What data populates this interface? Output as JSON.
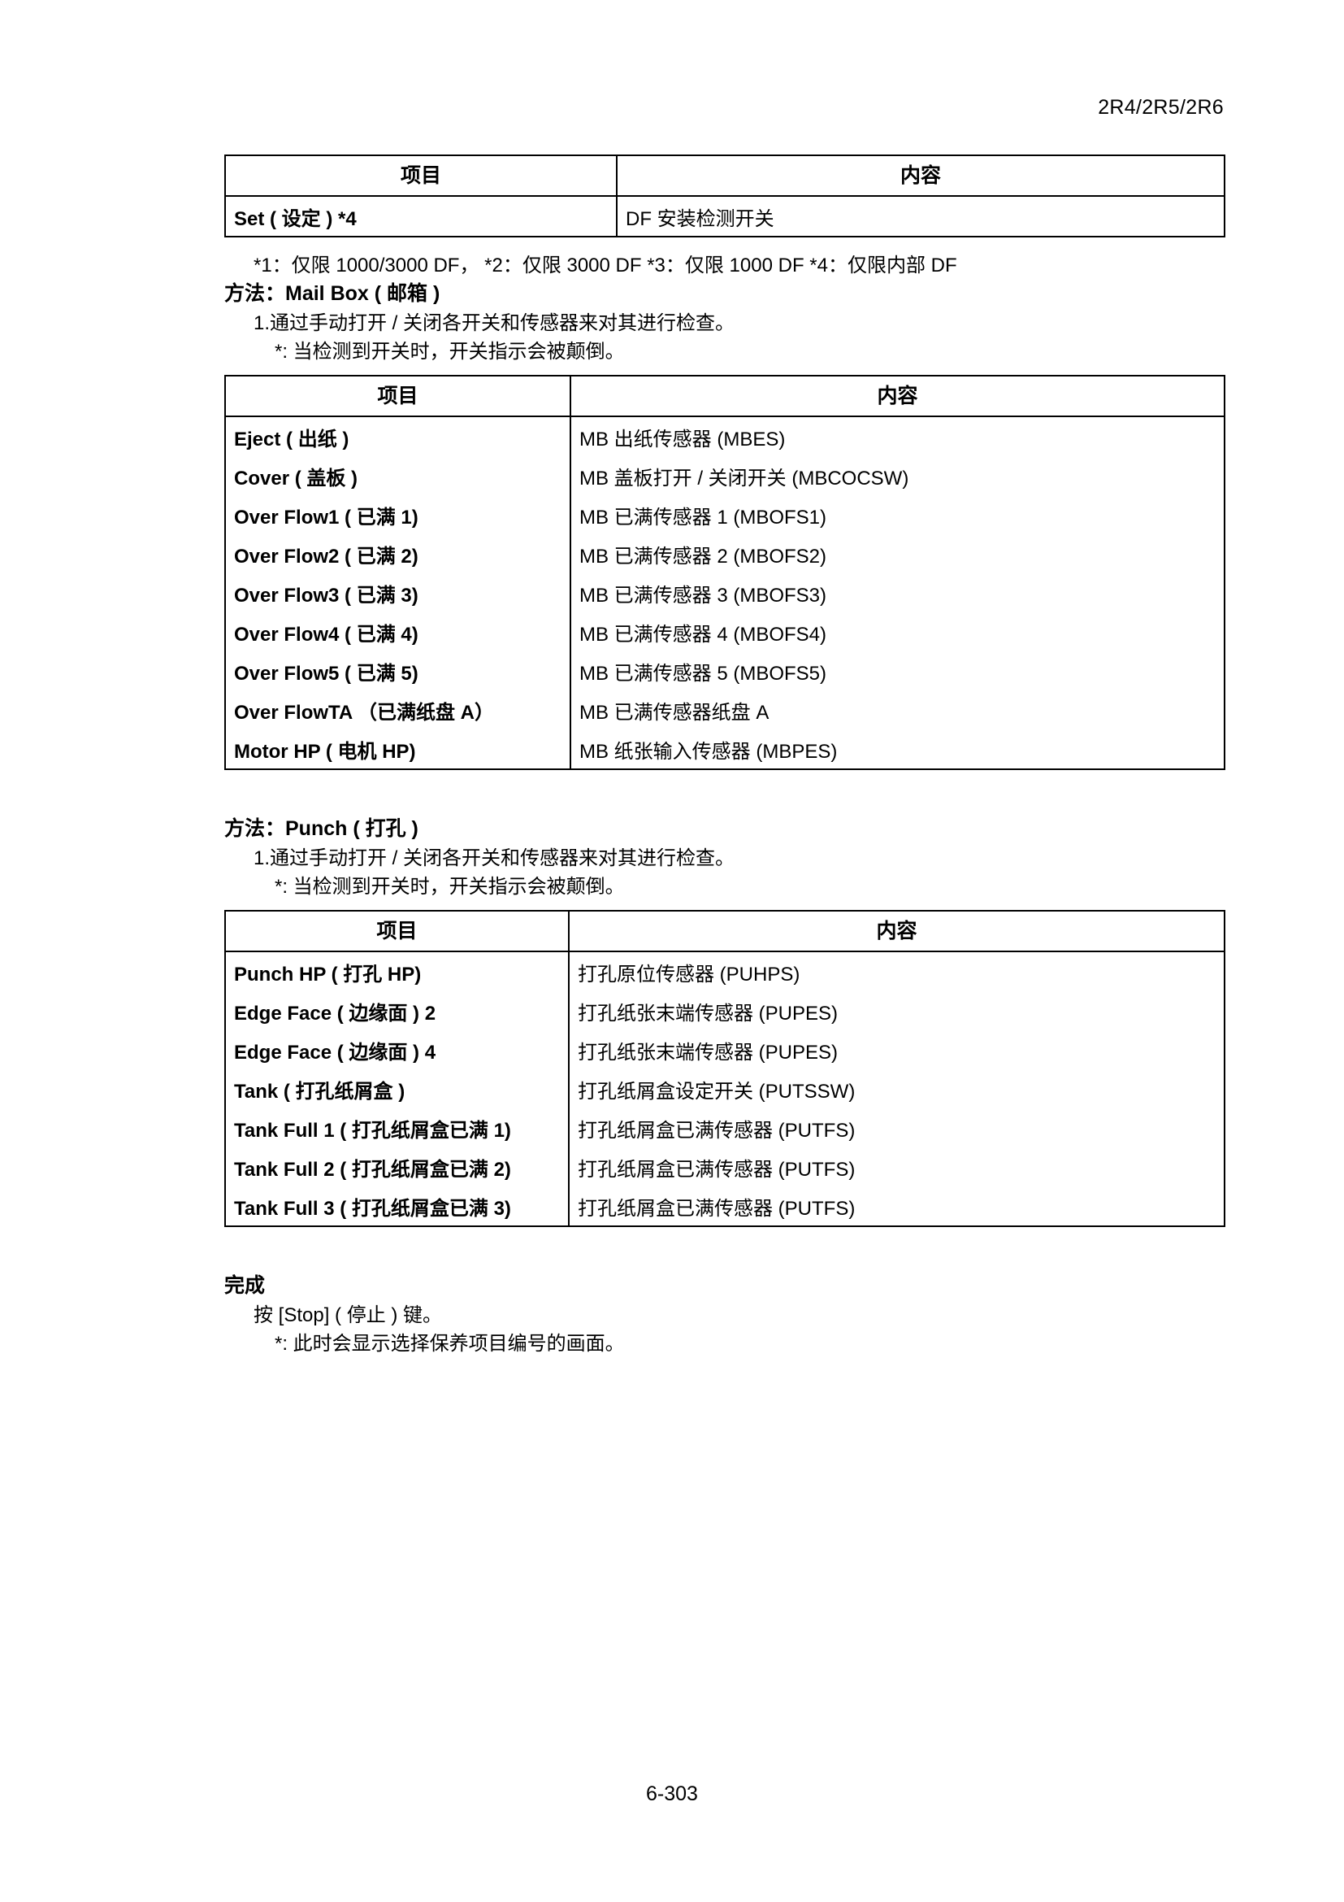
{
  "header": {
    "model_code": "2R4/2R5/2R6"
  },
  "table_set": {
    "headers": [
      "项目",
      "内容"
    ],
    "rows": [
      {
        "item": "Set ( 设定 ) *4",
        "content": "DF 安装检测开关"
      }
    ]
  },
  "footnote": "*1：仅限 1000/3000 DF，  *2：仅限 3000 DF *3：仅限 1000 DF *4：仅限内部 DF",
  "mailbox_section": {
    "heading": "方法：Mail Box ( 邮箱 )",
    "step": "1.通过手动打开 / 关闭各开关和传感器来对其进行检查。",
    "note": "*: 当检测到开关时，开关指示会被颠倒。",
    "table": {
      "headers": [
        "项目",
        "内容"
      ],
      "rows": [
        {
          "item": "Eject ( 出纸 )",
          "content": "MB 出纸传感器 (MBES)"
        },
        {
          "item": "Cover ( 盖板 )",
          "content": "MB 盖板打开 / 关闭开关 (MBCOCSW)"
        },
        {
          "item": "Over Flow1 ( 已满 1)",
          "content": "MB 已满传感器 1 (MBOFS1)"
        },
        {
          "item": "Over Flow2 ( 已满 2)",
          "content": "MB 已满传感器 2 (MBOFS2)"
        },
        {
          "item": "Over Flow3 ( 已满 3)",
          "content": "MB 已满传感器 3 (MBOFS3)"
        },
        {
          "item": "Over Flow4 ( 已满 4)",
          "content": "MB 已满传感器 4 (MBOFS4)"
        },
        {
          "item": "Over Flow5 ( 已满 5)",
          "content": "MB 已满传感器 5 (MBOFS5)"
        },
        {
          "item": "Over FlowTA （已满纸盘 A）",
          "content": "MB 已满传感器纸盘 A"
        },
        {
          "item": "Motor HP ( 电机 HP)",
          "content": "MB 纸张输入传感器 (MBPES)"
        }
      ]
    }
  },
  "punch_section": {
    "heading": "方法：Punch ( 打孔 )",
    "step": "1.通过手动打开 / 关闭各开关和传感器来对其进行检查。",
    "note": "*: 当检测到开关时，开关指示会被颠倒。",
    "table": {
      "headers": [
        "项目",
        "内容"
      ],
      "rows": [
        {
          "item": "Punch HP ( 打孔 HP)",
          "content": "打孔原位传感器 (PUHPS)"
        },
        {
          "item": "Edge Face ( 边缘面 ) 2",
          "content": "打孔纸张末端传感器 (PUPES)"
        },
        {
          "item": "Edge Face ( 边缘面 ) 4",
          "content": "打孔纸张末端传感器 (PUPES)"
        },
        {
          "item": "Tank ( 打孔纸屑盒 )",
          "content": "打孔纸屑盒设定开关 (PUTSSW)"
        },
        {
          "item": "Tank Full 1 ( 打孔纸屑盒已满 1)",
          "content": "打孔纸屑盒已满传感器 (PUTFS)"
        },
        {
          "item": "Tank Full 2 ( 打孔纸屑盒已满 2)",
          "content": "打孔纸屑盒已满传感器 (PUTFS)"
        },
        {
          "item": "Tank Full 3 ( 打孔纸屑盒已满 3)",
          "content": "打孔纸屑盒已满传感器 (PUTFS)"
        }
      ]
    }
  },
  "completion_section": {
    "heading": "完成",
    "step": "按 [Stop] ( 停止 ) 键。",
    "note": "*: 此时会显示选择保养项目编号的画面。"
  },
  "footer": {
    "page_number": "6-303"
  }
}
